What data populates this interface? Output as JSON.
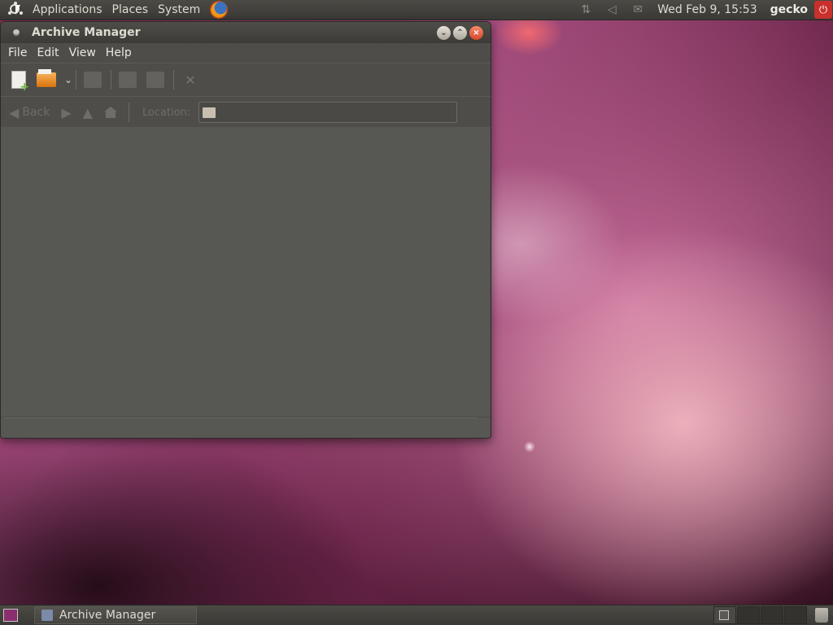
{
  "top_panel": {
    "menus": [
      "Applications",
      "Places",
      "System"
    ],
    "clock": "Wed Feb  9, 15:53",
    "username": "gecko"
  },
  "window": {
    "title": "Archive Manager",
    "menubar": {
      "file": "File",
      "edit": "Edit",
      "view": "View",
      "help": "Help"
    },
    "location_bar": {
      "back_label": "Back",
      "location_label": "Location:",
      "location_value": ""
    }
  },
  "bottom_panel": {
    "tasks": [
      "Archive Manager"
    ]
  },
  "icons": {
    "ubuntu_menu": "ubuntu-logo-icon",
    "browser": "firefox-icon",
    "network": "network-icon",
    "volume": "volume-icon",
    "mail": "mail-icon",
    "power": "power-icon",
    "new_archive": "new-archive-icon",
    "open_archive": "open-archive-icon",
    "trash": "trash-icon"
  },
  "colors": {
    "panel": "#3c3b37",
    "window_bg": "#575753",
    "close_button": "#d8462a",
    "power_button": "#c9302c"
  }
}
